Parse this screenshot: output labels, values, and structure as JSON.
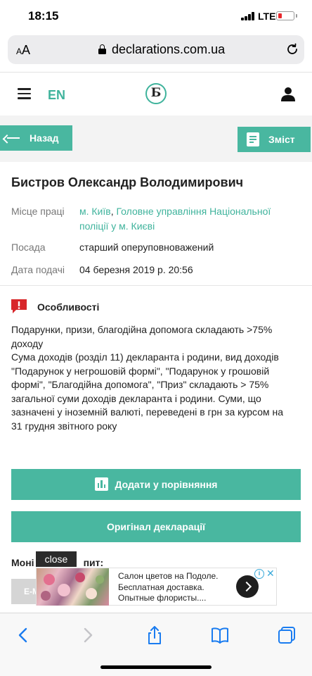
{
  "status_bar": {
    "time": "18:15",
    "network": "LTE"
  },
  "browser": {
    "text_size_label": "AA",
    "url": "declarations.com.ua"
  },
  "header": {
    "lang": "EN",
    "logo_glyph": "Б"
  },
  "nav": {
    "back_label": "Назад",
    "toc_label": "Зміст"
  },
  "person": {
    "name": "Бистров Олександр Володимирович",
    "rows": [
      {
        "label": "Місце праці",
        "city": "м. Київ",
        "sep": ", ",
        "org": "Головне управління Національної поліції у м. Києві"
      },
      {
        "label": "Посада",
        "value": "старший оперуповноважений"
      },
      {
        "label": "Дата подачі",
        "value": "04 березня 2019 р. 20:56"
      }
    ]
  },
  "features": {
    "title": "Особливості",
    "headline": "Подарунки, призи, благодійна допомога складають >75% доходу",
    "description": "Сума доходів (розділ 11) декларанта і родини, вид доходів \"Подарунок у негрошовій формі\", \"Подарунок у грошовій формі\", \"Благодійна допомога\", \"Приз\" складають > 75% загальної суми доходів декларанта і родини. Суми, що зазначені у іноземній валюті, переведені в грн за курсом на 31 грудня звітного року"
  },
  "actions": {
    "compare_label": "Додати у порівняння",
    "original_label": "Оригінал декларації"
  },
  "monitor": {
    "label_visible": "Моні",
    "label_tail": "пит:",
    "button_fragment": "E-M"
  },
  "ad": {
    "close_label": "close",
    "text": "Салон цветов на Подоле. Бесплатная доставка. Опытные флористы....",
    "info_glyph": "i",
    "x_glyph": "✕"
  },
  "colors": {
    "accent": "#49b7a0",
    "link": "#3fb39c",
    "alert": "#d8262a"
  }
}
